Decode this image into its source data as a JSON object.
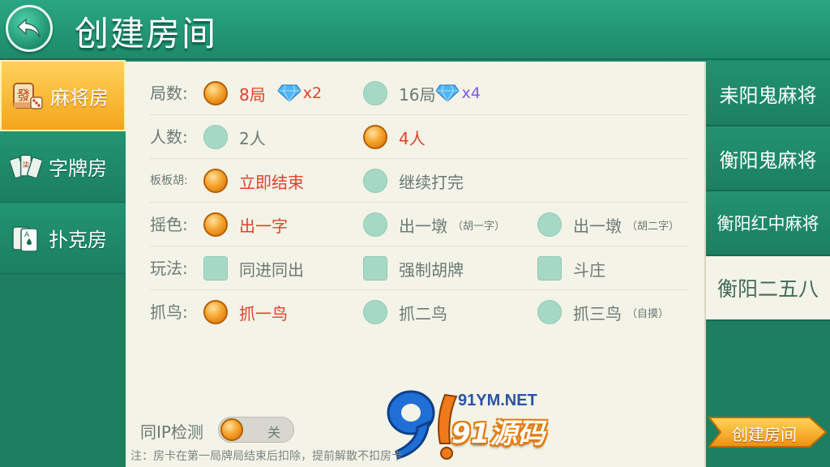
{
  "header": {
    "title": "创建房间"
  },
  "left_tabs": [
    {
      "label": "麻将房",
      "active": true,
      "icon": "mahjong-tile-icon"
    },
    {
      "label": "字牌房",
      "active": false,
      "icon": "cards-fan-icon"
    },
    {
      "label": "扑克房",
      "active": false,
      "icon": "poker-card-icon"
    }
  ],
  "rows": [
    {
      "label": "局数:",
      "options": [
        {
          "text": "8局",
          "selected": true,
          "multiplier": "x2"
        },
        {
          "text": "16局",
          "selected": false,
          "multiplier": "x4"
        }
      ]
    },
    {
      "label": "人数:",
      "options": [
        {
          "text": "2人",
          "selected": false
        },
        {
          "text": "4人",
          "selected": true
        }
      ]
    },
    {
      "label": "板板胡:",
      "options": [
        {
          "text": "立即结束",
          "selected": true
        },
        {
          "text": "继续打完",
          "selected": false
        }
      ]
    },
    {
      "label": "摇色:",
      "options": [
        {
          "text": "出一字",
          "selected": true
        },
        {
          "text": "出一墩",
          "sub": "（胡一字）",
          "selected": false
        },
        {
          "text": "出一墩",
          "sub": "（胡二字）",
          "selected": false
        }
      ]
    },
    {
      "label": "玩法:",
      "options": [
        {
          "text": "同进同出",
          "checked": false
        },
        {
          "text": "强制胡牌",
          "checked": false
        },
        {
          "text": "斗庄",
          "checked": false
        }
      ]
    },
    {
      "label": "抓鸟:",
      "options": [
        {
          "text": "抓一鸟",
          "selected": true
        },
        {
          "text": "抓二鸟",
          "selected": false
        },
        {
          "text": "抓三鸟",
          "sub": "（自摸）",
          "selected": false
        }
      ]
    }
  ],
  "ip_check": {
    "label": "同IP检测",
    "state": "关"
  },
  "note": "注：房卡在第一局牌局结束后扣除，提前解散不扣房卡",
  "watermark": {
    "url": "91YM.NET",
    "brand": "91源码"
  },
  "right_tabs": [
    {
      "label": "耒阳鬼麻将",
      "active": false
    },
    {
      "label": "衡阳鬼麻将",
      "active": false
    },
    {
      "label": "衡阳红中麻将",
      "active": false
    },
    {
      "label": "衡阳二五八",
      "active": true
    }
  ],
  "create_button": {
    "label": "创建房间"
  },
  "colors": {
    "header_green": "#2aa683",
    "panel_bg": "#f4f3e7",
    "selected_text": "#e0412a",
    "accent_orange": "#f5a52e",
    "radio_off": "#a5d9c6"
  }
}
